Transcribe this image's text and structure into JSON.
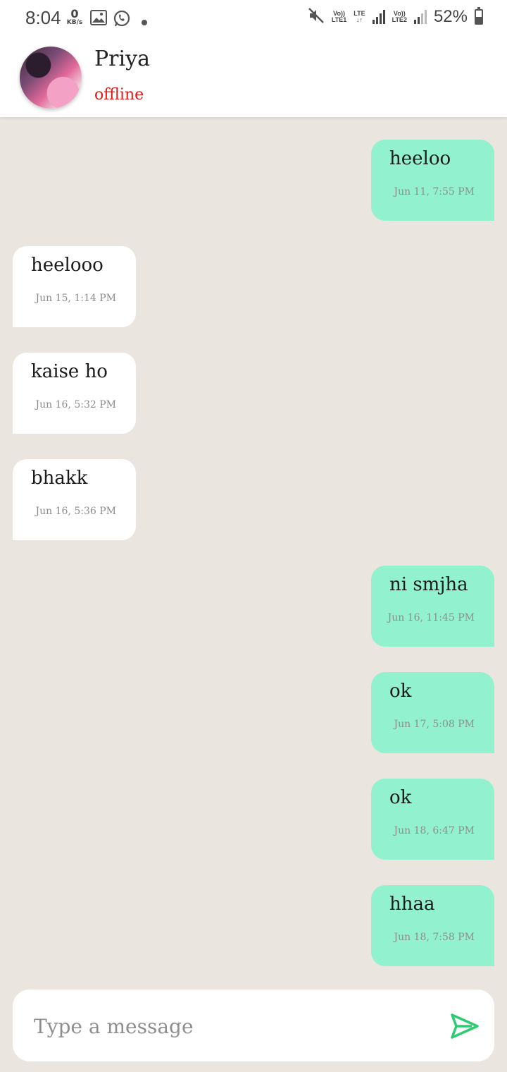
{
  "status_bar": {
    "time": "8:04",
    "speed_value": "0",
    "speed_unit": "KB/s",
    "network1_top": "Vo))",
    "network1_bottom": "LTE1",
    "network2_top": "LTE",
    "network3_top": "Vo))",
    "network3_bottom": "LTE2",
    "battery_percent": "52%",
    "battery_level": 0.52,
    "icons": [
      "image-icon",
      "whatsapp-icon",
      "dot-icon",
      "mute-icon",
      "signal-icon",
      "battery-icon"
    ]
  },
  "header": {
    "contact_name": "Priya",
    "contact_status": "offline",
    "status_color": "#e01919"
  },
  "messages": [
    {
      "direction": "out",
      "text": "heeloo",
      "time": "Jun 11, 7:55 PM"
    },
    {
      "direction": "in",
      "text": "heelooo",
      "time": "Jun 15, 1:14 PM"
    },
    {
      "direction": "in",
      "text": "kaise ho",
      "time": "Jun 16, 5:32 PM"
    },
    {
      "direction": "in",
      "text": "bhakk",
      "time": "Jun 16, 5:36 PM"
    },
    {
      "direction": "out",
      "text": "ni smjha",
      "time": "Jun 16, 11:45 PM"
    },
    {
      "direction": "out",
      "text": "ok",
      "time": "Jun 17, 5:08 PM"
    },
    {
      "direction": "out",
      "text": "ok",
      "time": "Jun 18, 6:47 PM"
    },
    {
      "direction": "out",
      "text": "hhaa",
      "time": "Jun 18, 7:58 PM"
    }
  ],
  "composer": {
    "placeholder": "Type a message",
    "value": "",
    "send_icon": "send-icon",
    "send_color": "#2ecc71"
  },
  "colors": {
    "outgoing_bubble": "#92f2d0",
    "incoming_bubble": "#ffffff",
    "chat_background": "#ebe5df"
  }
}
